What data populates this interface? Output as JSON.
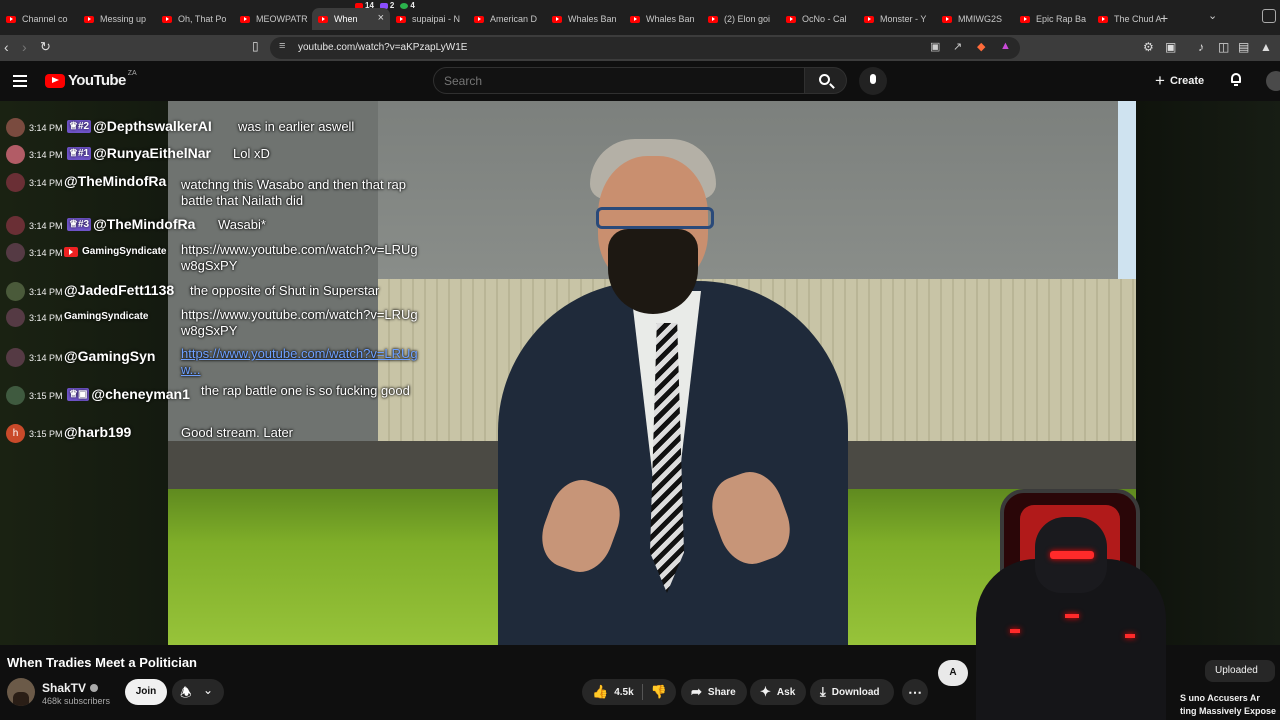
{
  "browser": {
    "badges": [
      {
        "count": "14",
        "color": "#ff0000"
      },
      {
        "count": "2",
        "color": "#8a4dff"
      },
      {
        "count": "4",
        "color": "#2bb24c"
      }
    ],
    "tabs": [
      {
        "label": "Channel co"
      },
      {
        "label": "Messing up"
      },
      {
        "label": "Oh, That Po"
      },
      {
        "label": "MEOWPATR"
      },
      {
        "label": "When",
        "active": true
      },
      {
        "label": "supaipai - N"
      },
      {
        "label": "American D"
      },
      {
        "label": "Whales Ban"
      },
      {
        "label": "Whales Ban"
      },
      {
        "label": "(2) Elon goi"
      },
      {
        "label": "OcNo - Cal"
      },
      {
        "label": "Monster - Y"
      },
      {
        "label": "MMIWG2S"
      },
      {
        "label": "Epic Rap Ba"
      },
      {
        "label": "The Chud A"
      }
    ],
    "url": "youtube.com/watch?v=aKPzapLyW1E"
  },
  "youtube": {
    "logo_text": "YouTube",
    "country": "ZA",
    "search_placeholder": "Search",
    "create_label": "Create"
  },
  "chat": [
    {
      "time": "3:14 PM",
      "rank": "#2",
      "user": "@DepthswalkerAI",
      "text": "was in earlier aswell",
      "avatar_color": "#7a4b3f"
    },
    {
      "time": "3:14 PM",
      "rank": "#1",
      "user": "@RunyaEithelNar",
      "text": "Lol xD",
      "avatar_color": "#b25c66"
    },
    {
      "time": "3:14 PM",
      "rank": "",
      "user": "@TheMindofRa",
      "text": "watchng this Wasabo and then that rap battle that Nailath did",
      "avatar_color": "#6a2f35"
    },
    {
      "time": "3:14 PM",
      "rank": "#3",
      "user": "@TheMindofRa",
      "text": "Wasabi*",
      "avatar_color": "#6a2f35"
    },
    {
      "time": "3:14 PM",
      "rank": "",
      "user": "GamingSyndicate",
      "text": "https://www.youtube.com/watch?v=LRUgw8gSxPY",
      "avatar_color": "#553a44",
      "source": "youtube"
    },
    {
      "time": "3:14 PM",
      "rank": "",
      "user": "@JadedFett1138",
      "text": "the opposite of Shut in Superstar",
      "avatar_color": "#4a5a3a"
    },
    {
      "time": "3:14 PM",
      "rank": "",
      "user": "GamingSyndicate",
      "text": "https://www.youtube.com/watch?v=LRUgw8gSxPY",
      "avatar_color": "#553a44"
    },
    {
      "time": "3:14 PM",
      "rank": "",
      "user": "@GamingSyn",
      "text": "https://www.youtube.com/watch?v=LRUgw...",
      "avatar_color": "#553a44",
      "link": true
    },
    {
      "time": "3:15 PM",
      "rank": "",
      "user": "@cheneyman1",
      "text": "the rap battle one is so fucking good",
      "avatar_color": "#3f5a3f",
      "membership": true
    },
    {
      "time": "3:15 PM",
      "rank": "",
      "user": "@harb199",
      "text": "Good stream. Later",
      "avatar_color": "#c94a2a",
      "initial": "h"
    }
  ],
  "video": {
    "title": "When Tradies Meet a Politician",
    "channel": "ShakTV",
    "subscribers": "468k subscribers",
    "join_label": "Join",
    "likes": "4.5k",
    "share_label": "Share",
    "ask_label": "Ask",
    "download_label": "Download",
    "aside_letter": "A",
    "uploaded_label": "Uploaded",
    "recommendations": [
      "S",
      "uno Accusers Ar",
      "ting Massively Expose"
    ]
  },
  "icons": {
    "menu": "hamburger-icon",
    "search": "search-icon",
    "mic": "microphone-icon",
    "bell": "bell-icon",
    "like": "thumbs-up-icon",
    "dislike": "thumbs-down-icon",
    "share": "share-icon",
    "ask": "sparkle-icon",
    "download": "download-icon"
  }
}
